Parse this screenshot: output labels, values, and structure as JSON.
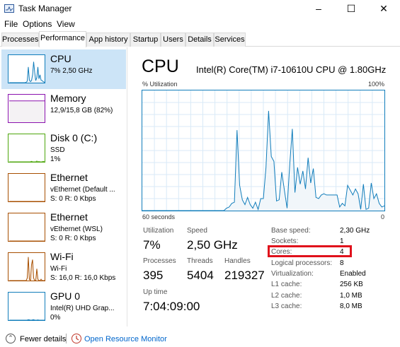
{
  "window": {
    "title": "Task Manager",
    "minimize_glyph": "–",
    "maximize_glyph": "☐",
    "close_glyph": "✕",
    "icon": "task-manager-icon"
  },
  "menu": [
    "File",
    "Options",
    "View"
  ],
  "tabs": [
    "Processes",
    "Performance",
    "App history",
    "Startup",
    "Users",
    "Details",
    "Services"
  ],
  "active_tab": "Performance",
  "sidebar": [
    {
      "name": "CPU",
      "line1": "7% 2,50 GHz",
      "line2": "",
      "color": "#117dbb",
      "fill": "#f1f6fa",
      "selected": true
    },
    {
      "name": "Memory",
      "line1": "12,9/15,8 GB (82%)",
      "line2": "",
      "color": "#8b12ae",
      "fill": "#f4f2f4",
      "selected": false
    },
    {
      "name": "Disk 0 (C:)",
      "line1": "SSD",
      "line2": "1%",
      "color": "#4da60c",
      "fill": "#eff7e9",
      "selected": false
    },
    {
      "name": "Ethernet",
      "line1": "vEthernet (Default ...",
      "line2": "S: 0 R: 0 Kbps",
      "color": "#a74f01",
      "fill": "#fcf3eb",
      "selected": false
    },
    {
      "name": "Ethernet",
      "line1": "vEthernet (WSL)",
      "line2": "S: 0 R: 0 Kbps",
      "color": "#a74f01",
      "fill": "#fcf3eb",
      "selected": false
    },
    {
      "name": "Wi-Fi",
      "line1": "Wi-Fi",
      "line2": "S: 16,0 R: 16,0 Kbps",
      "color": "#a74f01",
      "fill": "#fcf3eb",
      "selected": false
    },
    {
      "name": "GPU 0",
      "line1": "Intel(R) UHD Grap...",
      "line2": "0%",
      "color": "#117dbb",
      "fill": "#f1f6fa",
      "selected": false
    }
  ],
  "main": {
    "title": "CPU",
    "model": "Intel(R) Core(TM) i7-10610U CPU @ 1.80GHz",
    "graph_label_left": "% Utilization",
    "graph_label_right": "100%",
    "axis_left": "60 seconds",
    "axis_right": "0",
    "graph_color": "#117dbb",
    "graph_fill": "#f1f6fa",
    "grid_color": "#d9eaf7"
  },
  "chart_data": {
    "type": "area",
    "title": "",
    "xlabel": "",
    "ylabel": "% Utilization",
    "ylim": [
      0,
      100
    ],
    "x_range_seconds": [
      60,
      0
    ],
    "values": [
      0,
      0,
      0,
      0,
      0,
      0,
      0,
      0,
      0,
      0,
      0,
      0,
      0,
      0,
      0,
      0,
      0,
      0,
      0,
      0,
      0,
      0,
      0,
      0,
      0,
      0,
      0,
      0,
      0,
      0,
      0,
      0,
      2,
      3,
      6,
      7,
      67,
      21,
      9,
      5,
      11,
      5,
      2,
      7,
      1,
      10,
      10,
      36,
      83,
      45,
      41,
      8,
      9,
      32,
      17,
      2,
      38,
      68,
      15,
      36,
      22,
      33,
      18,
      44,
      23,
      35,
      11,
      10,
      13,
      14,
      13,
      13,
      13,
      13,
      13,
      3,
      6,
      4,
      21,
      17,
      13,
      18,
      14,
      1,
      22,
      1,
      2,
      23,
      10,
      14,
      6,
      3,
      4
    ]
  },
  "stats": {
    "utilization": {
      "label": "Utilization",
      "value": "7%"
    },
    "speed": {
      "label": "Speed",
      "value": "2,50 GHz"
    },
    "processes": {
      "label": "Processes",
      "value": "395"
    },
    "threads": {
      "label": "Threads",
      "value": "5404"
    },
    "handles": {
      "label": "Handles",
      "value": "219327"
    },
    "uptime": {
      "label": "Up time",
      "value": "7:04:09:00"
    }
  },
  "specs": [
    {
      "k": "Base speed:",
      "v": "2,30 GHz"
    },
    {
      "k": "Sockets:",
      "v": "1"
    },
    {
      "k": "Cores:",
      "v": "4"
    },
    {
      "k": "Logical processors:",
      "v": "8"
    },
    {
      "k": "Virtualization:",
      "v": "Enabled"
    },
    {
      "k": "L1 cache:",
      "v": "256 KB"
    },
    {
      "k": "L2 cache:",
      "v": "1,0 MB"
    },
    {
      "k": "L3 cache:",
      "v": "8,0 MB"
    }
  ],
  "footer": {
    "fewer_details": "Fewer details",
    "fewer_glyph": "⌃",
    "resource_monitor": "Open Resource Monitor"
  },
  "thumb_series": {
    "cpu": [
      0,
      0,
      0,
      0,
      0,
      0,
      0,
      0,
      0,
      0,
      0,
      0,
      0,
      0,
      0,
      0,
      2,
      6,
      60,
      10,
      4,
      8,
      30,
      80,
      40,
      8,
      20,
      60,
      15,
      30,
      10,
      8,
      4,
      2,
      1
    ],
    "memory": [
      82,
      82,
      82,
      82,
      82,
      82,
      82,
      82,
      82,
      82,
      82,
      82,
      82,
      82,
      82,
      82,
      82,
      82,
      82,
      82,
      82,
      82,
      82,
      82,
      82,
      82,
      82,
      82,
      82,
      82,
      82,
      82,
      82,
      82,
      82
    ],
    "disk": [
      0,
      0,
      0,
      0,
      0,
      0,
      0,
      0,
      0,
      0,
      0,
      0,
      0,
      0,
      0,
      0,
      0,
      0,
      0,
      0,
      0,
      2,
      0,
      0,
      0,
      0,
      3,
      0,
      1,
      0,
      0,
      0,
      2,
      0,
      1
    ],
    "eth1": [
      0,
      0,
      0,
      0,
      0,
      0,
      0,
      0,
      0,
      0,
      0,
      0,
      0,
      0,
      0,
      0,
      0,
      0,
      0,
      0,
      0,
      0,
      0,
      0,
      0,
      0,
      0,
      0,
      0,
      0,
      0,
      0,
      0,
      0,
      0
    ],
    "eth2": [
      0,
      0,
      0,
      0,
      0,
      0,
      0,
      0,
      0,
      0,
      0,
      0,
      0,
      0,
      0,
      0,
      0,
      0,
      0,
      0,
      0,
      0,
      0,
      0,
      0,
      0,
      0,
      0,
      0,
      0,
      0,
      0,
      0,
      0,
      0
    ],
    "wifi": [
      0,
      0,
      0,
      0,
      0,
      0,
      0,
      0,
      0,
      0,
      0,
      0,
      0,
      0,
      0,
      0,
      0,
      10,
      90,
      5,
      0,
      60,
      80,
      10,
      0,
      0,
      45,
      5,
      0,
      0,
      5,
      0,
      0,
      0,
      0
    ],
    "gpu": [
      0,
      0,
      0,
      0,
      0,
      0,
      0,
      0,
      0,
      0,
      0,
      0,
      0,
      0,
      0,
      0,
      0,
      0,
      2,
      1,
      0,
      0,
      1,
      2,
      0,
      0,
      0,
      1,
      0,
      0,
      0,
      0,
      0,
      0,
      0
    ]
  }
}
